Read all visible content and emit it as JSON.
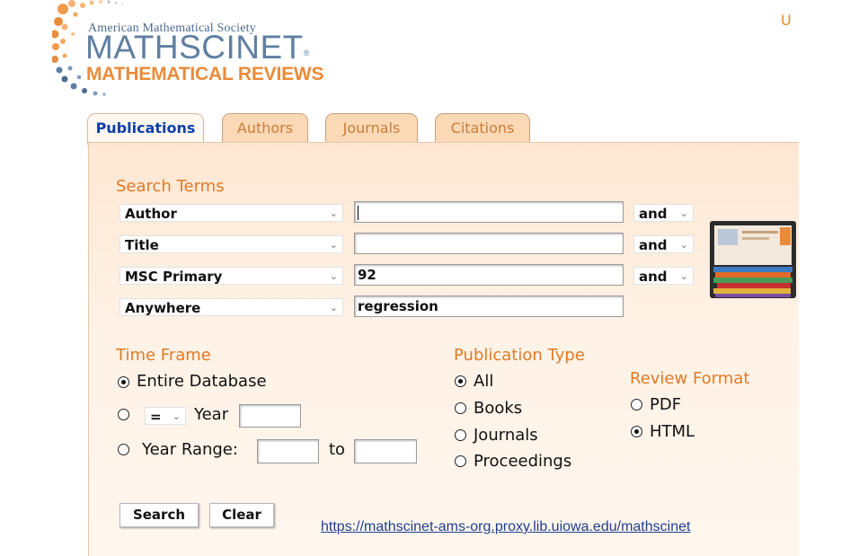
{
  "logo": {
    "org": "American Mathematical Society",
    "product": "MATHSCINET",
    "subtitle": "MATHEMATICAL REVIEWS",
    "colors": {
      "blue": "#5f7fa2",
      "orange": "#e98b3a"
    }
  },
  "corner_text": "U",
  "tabs": [
    {
      "label": "Publications",
      "active": true
    },
    {
      "label": "Authors",
      "active": false
    },
    {
      "label": "Journals",
      "active": false
    },
    {
      "label": "Citations",
      "active": false
    }
  ],
  "search_terms": {
    "title": "Search Terms",
    "rows": [
      {
        "field": "Author",
        "value": "",
        "operator": "and"
      },
      {
        "field": "Title",
        "value": "",
        "operator": "and"
      },
      {
        "field": "MSC Primary",
        "value": "92",
        "operator": "and"
      },
      {
        "field": "Anywhere",
        "value": "regression",
        "operator": ""
      }
    ]
  },
  "time_frame": {
    "title": "Time Frame",
    "entire": "Entire Database",
    "year_op": "=",
    "year_label": "Year",
    "range_label": "Year Range:",
    "to_label": "to",
    "selected": "entire"
  },
  "publication_type": {
    "title": "Publication Type",
    "options": [
      "All",
      "Books",
      "Journals",
      "Proceedings"
    ],
    "selected": "All"
  },
  "review_format": {
    "title": "Review Format",
    "options": [
      "PDF",
      "HTML"
    ],
    "selected": "HTML"
  },
  "buttons": {
    "search": "Search",
    "clear": "Clear"
  },
  "url": "https://mathscinet-ams-org.proxy.lib.uiowa.edu/mathscinet",
  "colors": {
    "accent": "#de7a28",
    "tab_bg": "#fbd9b7",
    "active_tab_text": "#0d3fa7",
    "link": "#1f3f8f"
  },
  "icons": {
    "radio_on": "radio-selected-icon",
    "radio_off": "radio-unselected-icon",
    "dropdown": "chevron-down-icon"
  }
}
